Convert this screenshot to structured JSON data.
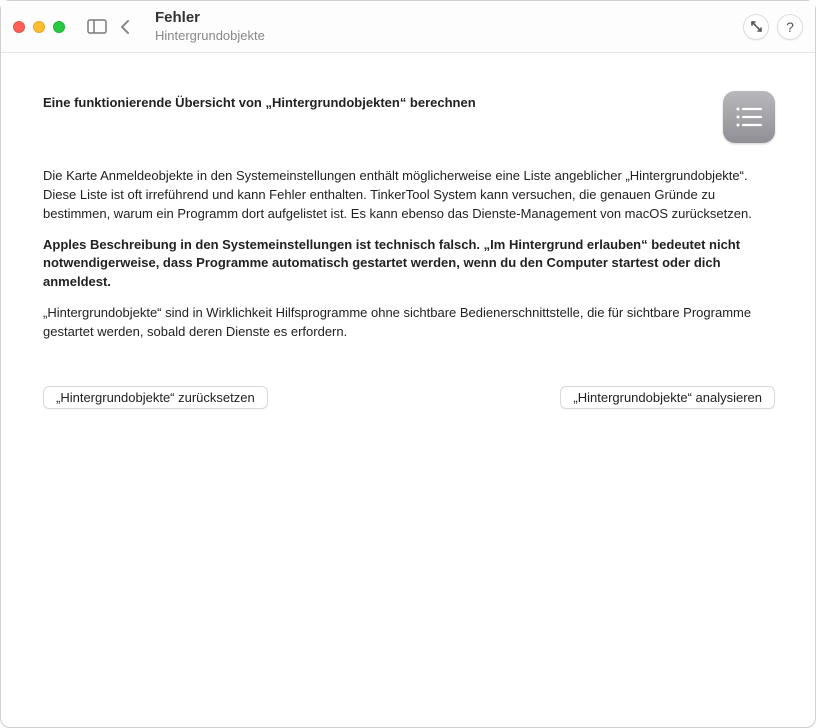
{
  "titlebar": {
    "title": "Fehler",
    "subtitle": "Hintergrundobjekte"
  },
  "content": {
    "heading": "Eine funktionierende Übersicht von „Hintergrundobjekten“ berechnen",
    "para1": "Die Karte Anmeldeobjekte in den Systemeinstellungen enthält möglicherweise eine Liste angeblicher „Hintergrundobjekte“. Diese Liste ist oft irreführend und kann Fehler enthalten. TinkerTool System kann versuchen, die genauen Gründe zu bestimmen, warum ein Programm dort aufgelistet ist. Es kann ebenso das Dienste-Management von macOS zurücksetzen.",
    "para2": "Apples Beschreibung in den Systemeinstellungen ist technisch falsch. „Im Hintergrund erlauben“ bedeutet nicht notwendigerweise, dass Programme automatisch gestartet werden, wenn du den Computer startest oder dich anmeldest.",
    "para3": "„Hintergrundobjekte“ sind in Wirklichkeit Hilfsprogramme ohne sichtbare Bedienerschnittstelle, die für sichtbare Programme gestartet werden, sobald deren Dienste es erfordern.",
    "reset_button": "„Hintergrundobjekte“ zurücksetzen",
    "analyze_button": "„Hintergrundobjekte“ analysieren"
  },
  "help_label": "?"
}
